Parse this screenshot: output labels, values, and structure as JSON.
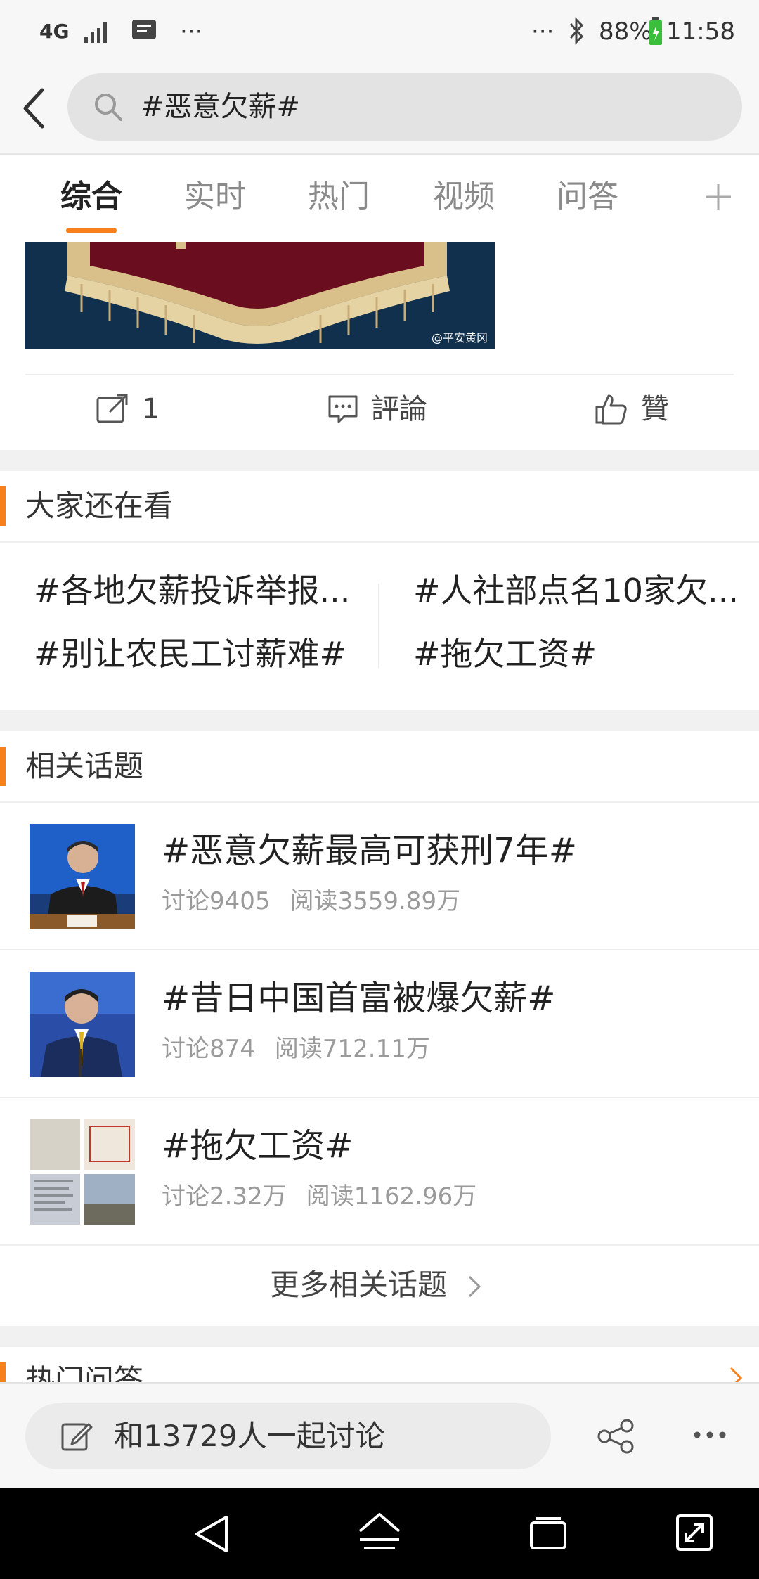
{
  "status": {
    "network": "4G",
    "dots": "···",
    "battery": "88%",
    "time": "11:58"
  },
  "search": {
    "query": "#恶意欠薪#"
  },
  "tabs": [
    {
      "label": "综合",
      "active": true
    },
    {
      "label": "实时"
    },
    {
      "label": "热门"
    },
    {
      "label": "视频"
    },
    {
      "label": "问答"
    }
  ],
  "card": {
    "watermark": "@平安黄冈",
    "repost_count": "1",
    "comment_label": "評論",
    "like_label": "贊"
  },
  "everyone_watching": {
    "title": "大家还在看",
    "tags": [
      "#各地欠薪投诉举报...",
      "#人社部点名10家欠...",
      "#别让农民工讨薪难#",
      "#拖欠工资#"
    ]
  },
  "related_topics": {
    "title": "相关话题",
    "items": [
      {
        "title": "#恶意欠薪最高可获刑7年#",
        "discussions": "讨论9405",
        "reads": "阅读3559.89万"
      },
      {
        "title": "#昔日中国首富被爆欠薪#",
        "discussions": "讨论874",
        "reads": "阅读712.11万"
      },
      {
        "title": "#拖欠工资#",
        "discussions": "讨论2.32万",
        "reads": "阅读1162.96万"
      }
    ],
    "more_label": "更多相关话题"
  },
  "next_section": {
    "title": "热门问答"
  },
  "bottom": {
    "discuss_label": "和13729人一起讨论"
  },
  "colors": {
    "accent": "#f8801a"
  },
  "icons": [
    "back-icon",
    "search-icon",
    "add-tab-icon",
    "repost-icon",
    "comment-icon",
    "like-icon",
    "chevron-right-icon",
    "edit-icon",
    "share-icon",
    "more-icon"
  ]
}
